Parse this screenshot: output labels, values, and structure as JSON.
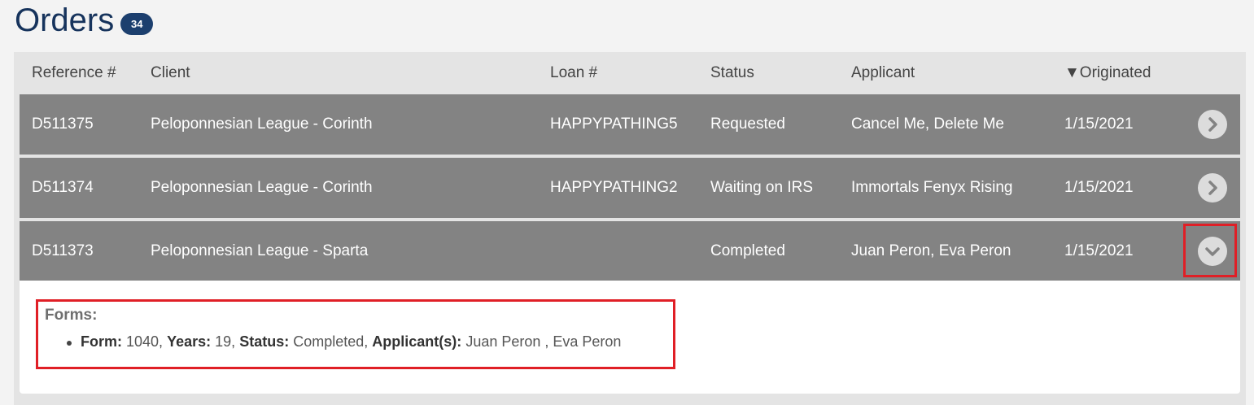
{
  "page": {
    "title": "Orders",
    "count": "34"
  },
  "table": {
    "columns": [
      "Reference #",
      "Client",
      "Loan #",
      "Status",
      "Applicant",
      "▼Originated"
    ],
    "rows": [
      {
        "reference": "D511375",
        "client": "Peloponnesian League - Corinth",
        "loan": "HAPPYPATHING5",
        "status": "Requested",
        "applicant": "Cancel Me, Delete Me",
        "originated": "1/15/2021",
        "toggle_icon": "chevron-right-icon"
      },
      {
        "reference": "D511374",
        "client": "Peloponnesian League - Corinth",
        "loan": "HAPPYPATHING2",
        "status": "Waiting on IRS",
        "applicant": "Immortals Fenyx Rising",
        "originated": "1/15/2021",
        "toggle_icon": "chevron-right-icon"
      },
      {
        "reference": "D511373",
        "client": "Peloponnesian League - Sparta",
        "loan": "",
        "status": "Completed",
        "applicant": "Juan Peron, Eva Peron",
        "originated": "1/15/2021",
        "toggle_icon": "chevron-down-icon",
        "expanded": true
      }
    ]
  },
  "detail": {
    "forms_title": "Forms:",
    "forms": [
      {
        "form_label": "Form:",
        "form_value": "1040,",
        "years_label": "Years:",
        "years_value": "19,",
        "status_label": "Status:",
        "status_value": "Completed,",
        "applicants_label": "Applicant(s):",
        "applicants_value": "Juan Peron , Eva Peron"
      }
    ]
  },
  "colors": {
    "title": "#16335c",
    "badge": "#1c3f6e",
    "row_bg": "#838383",
    "highlight": "#e01f26"
  }
}
